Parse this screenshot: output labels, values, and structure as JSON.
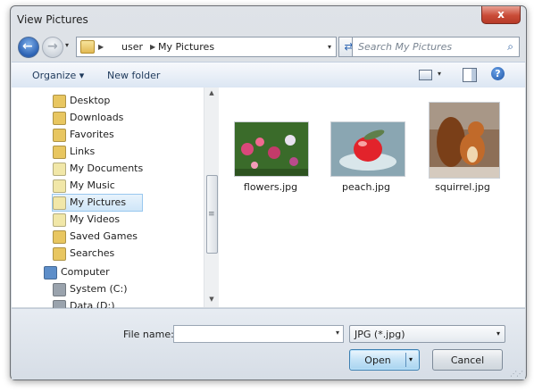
{
  "window": {
    "title": "View Pictures",
    "close_glyph": "x"
  },
  "nav": {
    "back_glyph": "←",
    "forward_glyph": "→",
    "dropdown_glyph": "▾"
  },
  "address": {
    "chevron": "▶",
    "crumbs": [
      "user",
      "My Pictures"
    ],
    "dropdown_glyph": "▾",
    "refresh_glyph": "⇄"
  },
  "search": {
    "placeholder": "Search My Pictures",
    "icon_glyph": "⌕"
  },
  "toolbar": {
    "organize_label": "Organize ▾",
    "new_folder_label": "New folder",
    "views_dropdown_glyph": "▾",
    "help_glyph": "?"
  },
  "sidebar": {
    "items": [
      {
        "label": "Desktop",
        "icon": "desktop-icon",
        "color": "#e8c660"
      },
      {
        "label": "Downloads",
        "icon": "downloads-icon",
        "color": "#e8c660"
      },
      {
        "label": "Favorites",
        "icon": "favorites-icon",
        "color": "#e8c660"
      },
      {
        "label": "Links",
        "icon": "links-icon",
        "color": "#e8c660"
      },
      {
        "label": "My Documents",
        "icon": "documents-icon",
        "color": "#f1e7a8"
      },
      {
        "label": "My Music",
        "icon": "music-icon",
        "color": "#f1e7a8"
      },
      {
        "label": "My Pictures",
        "icon": "pictures-icon",
        "color": "#f1e7a8"
      },
      {
        "label": "My Videos",
        "icon": "videos-icon",
        "color": "#f1e7a8"
      },
      {
        "label": "Saved Games",
        "icon": "saved-games-icon",
        "color": "#e8c660"
      },
      {
        "label": "Searches",
        "icon": "searches-icon",
        "color": "#e8c660"
      },
      {
        "label": "Computer",
        "icon": "computer-icon",
        "color": "#5d8ec9"
      },
      {
        "label": "System (C:)",
        "icon": "drive-icon",
        "color": "#9aa3ad"
      },
      {
        "label": "Data (D:)",
        "icon": "drive-icon",
        "color": "#9aa3ad"
      }
    ],
    "selected": "My Pictures",
    "scroll_up_glyph": "▲",
    "scroll_down_glyph": "▼",
    "grip_glyph": "≡"
  },
  "files": [
    {
      "name": "flowers.jpg",
      "colors": [
        "#3a6b2a",
        "#d9487a"
      ]
    },
    {
      "name": "peach.jpg",
      "colors": [
        "#5f7f4a",
        "#e2232b"
      ]
    },
    {
      "name": "squirrel.jpg",
      "colors": [
        "#8d6f57",
        "#c16a2a"
      ]
    }
  ],
  "bottom": {
    "file_name_label": "File name:",
    "file_name_value": "",
    "file_name_dropdown_glyph": "▾",
    "file_type": "JPG (*.jpg)",
    "file_type_dropdown_glyph": "▾",
    "open_label": "Open",
    "open_dropdown_glyph": "▾",
    "cancel_label": "Cancel",
    "grip_glyph": "⋰⋰"
  }
}
